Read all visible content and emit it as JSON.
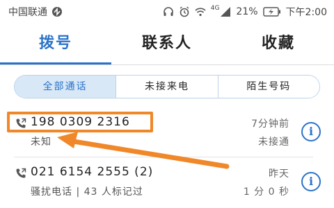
{
  "status_bar": {
    "carrier": "中国联通",
    "battery_percent": "21%",
    "time": "下午2:00",
    "signal_label": "4G"
  },
  "tabs": [
    {
      "label": "拨号",
      "active": true
    },
    {
      "label": "联系人",
      "active": false
    },
    {
      "label": "收藏",
      "active": false
    }
  ],
  "filters": [
    {
      "label": "全部通话",
      "active": true
    },
    {
      "label": "未接来电",
      "active": false
    },
    {
      "label": "陌生号码",
      "active": false
    }
  ],
  "calls": [
    {
      "number": "198 0309 2316",
      "sub": "未知",
      "time": "7分钟前",
      "detail": "未接通"
    },
    {
      "number": "021 6154 2555 (2)",
      "sub": "骚扰电话 | 43 人标记过",
      "time": "昨天",
      "detail": "1 分 0 秒"
    }
  ],
  "colors": {
    "accent": "#2a73c9",
    "annotation": "#f0882a"
  }
}
